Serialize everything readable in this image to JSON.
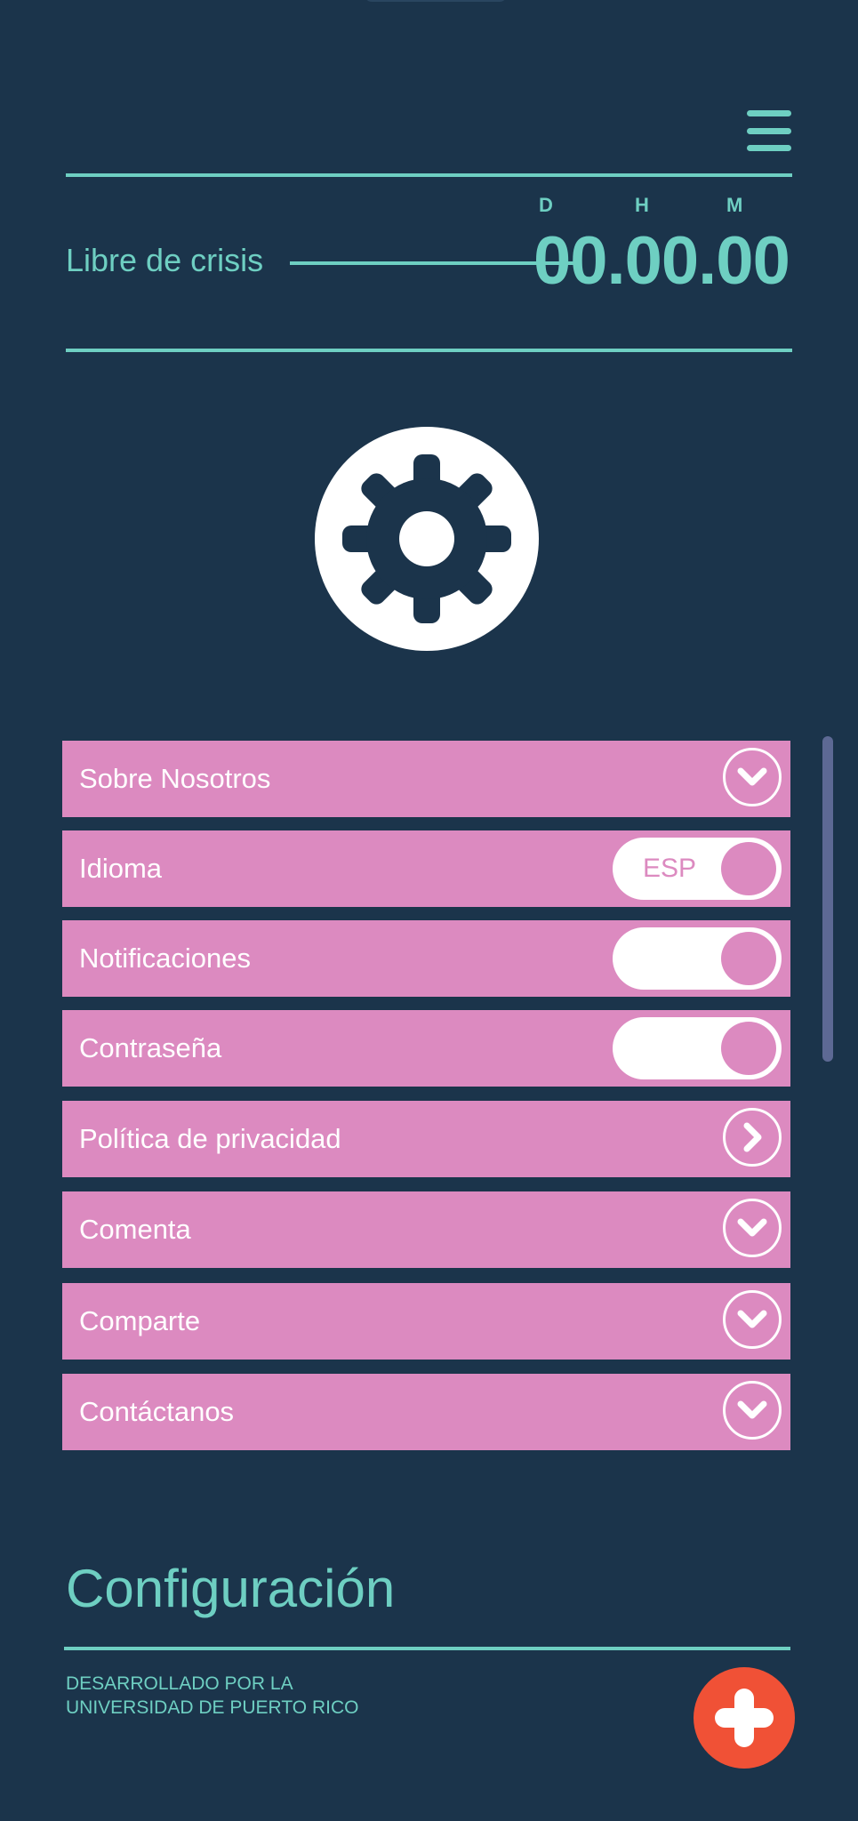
{
  "header": {
    "menu_icon": "hamburger-menu-icon",
    "status_label": "Libre de crisis",
    "timer": {
      "unit_labels": [
        "D",
        "H",
        "M"
      ],
      "value": "00.00.00"
    }
  },
  "settings_icon": "gear-icon",
  "menu": {
    "items": [
      {
        "label": "Sobre Nosotros",
        "control": "chevron-down-icon"
      },
      {
        "label": "Idioma",
        "control": "toggle",
        "toggle_text": "ESP"
      },
      {
        "label": "Notificaciones",
        "control": "toggle",
        "toggle_text": ""
      },
      {
        "label": "Contraseña",
        "control": "toggle",
        "toggle_text": ""
      },
      {
        "label": "Política de privacidad",
        "control": "chevron-right-icon"
      },
      {
        "label": "Comenta",
        "control": "chevron-down-icon"
      },
      {
        "label": "Comparte",
        "control": "chevron-down-icon"
      },
      {
        "label": "Contáctanos",
        "control": "chevron-down-icon"
      }
    ]
  },
  "page_title": "Configuración",
  "footer": {
    "line1": "DESARROLLADO POR LA",
    "line2": "UNIVERSIDAD DE PUERTO RICO",
    "fab_icon": "plus-icon"
  },
  "colors": {
    "background": "#1b344b",
    "accent": "#6ecfc2",
    "menu_item": "#dc8ac0",
    "fab": "#f05136",
    "scrollbar": "#5d6994"
  }
}
